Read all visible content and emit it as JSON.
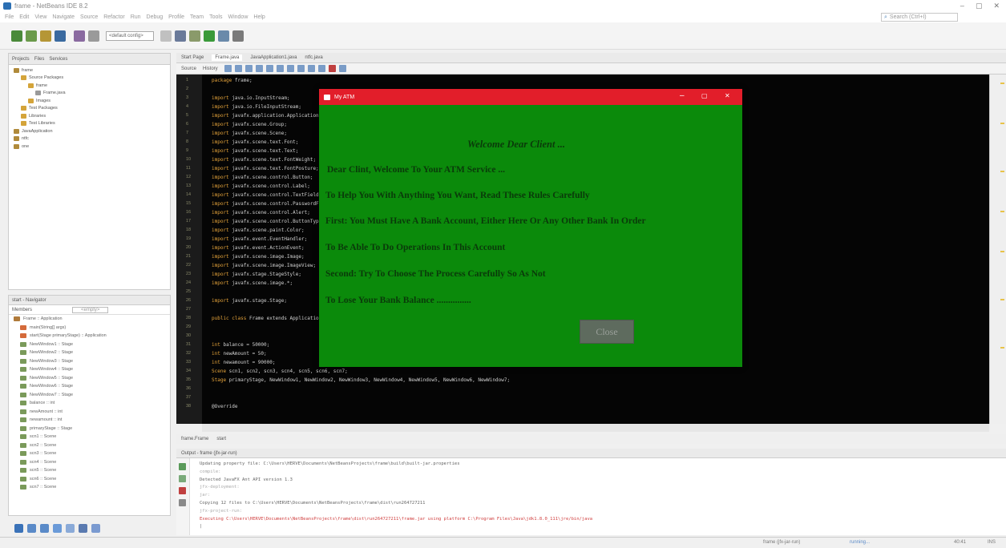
{
  "window": {
    "title": "frame - NetBeans IDE 8.2",
    "controls": [
      "–",
      "▢",
      "✕"
    ]
  },
  "menu": {
    "items": [
      "File",
      "Edit",
      "View",
      "Navigate",
      "Source",
      "Refactor",
      "Run",
      "Debug",
      "Profile",
      "Team",
      "Tools",
      "Window",
      "Help"
    ],
    "search_placeholder": "Search (Ctrl+I)"
  },
  "toolbar": {
    "config": "<default config>"
  },
  "projects": {
    "tabs": [
      "Projects",
      "Files",
      "Services"
    ],
    "tree": [
      {
        "label": "frame",
        "depth": 0
      },
      {
        "label": "Source Packages",
        "depth": 1
      },
      {
        "label": "frame",
        "depth": 2
      },
      {
        "label": "Frame.java",
        "depth": 3
      },
      {
        "label": "Images",
        "depth": 2
      },
      {
        "label": "Test Packages",
        "depth": 1
      },
      {
        "label": "Libraries",
        "depth": 1
      },
      {
        "label": "Test Libraries",
        "depth": 1
      },
      {
        "label": "JavaApplication",
        "depth": 0
      },
      {
        "label": "ntfc",
        "depth": 0
      },
      {
        "label": "one",
        "depth": 0
      }
    ]
  },
  "navigator": {
    "header": "start - Navigator",
    "members_label": "Members",
    "filter": "<empty>",
    "root": "Frame :: Application",
    "members": [
      "main(String[] args)",
      "start(Stage primaryStage) :: Application",
      "NewWindow1 :: Stage",
      "NewWindow2 :: Stage",
      "NewWindow3 :: Stage",
      "NewWindow4 :: Stage",
      "NewWindow5 :: Stage",
      "NewWindow6 :: Stage",
      "NewWindow7 :: Stage",
      "balance :: int",
      "newAmount :: int",
      "newamount :: int",
      "primaryStage :: Stage",
      "scn1 :: Scene",
      "scn2 :: Scene",
      "scn3 :: Scene",
      "scn4 :: Scene",
      "scn5 :: Scene",
      "scn6 :: Scene",
      "scn7 :: Scene"
    ]
  },
  "editor": {
    "tabs": [
      "Start Page",
      "Frame.java",
      "JavaApplication1.java",
      "ntfc.java"
    ],
    "source_label": "Source",
    "history_label": "History",
    "lines": [
      {
        "n": "1",
        "kw": "package",
        "rest": " frame;"
      },
      {
        "n": "2",
        "kw": "",
        "rest": ""
      },
      {
        "n": "3",
        "kw": "import",
        "rest": " java.io.InputStream;"
      },
      {
        "n": "4",
        "kw": "import",
        "rest": " java.io.FileInputStream;"
      },
      {
        "n": "5",
        "kw": "import",
        "rest": " javafx.application.Application;"
      },
      {
        "n": "6",
        "kw": "import",
        "rest": " javafx.scene.Group;"
      },
      {
        "n": "7",
        "kw": "import",
        "rest": " javafx.scene.Scene;"
      },
      {
        "n": "8",
        "kw": "import",
        "rest": " javafx.scene.text.Font;"
      },
      {
        "n": "9",
        "kw": "import",
        "rest": " javafx.scene.text.Text;"
      },
      {
        "n": "10",
        "kw": "import",
        "rest": " javafx.scene.text.FontWeight;"
      },
      {
        "n": "11",
        "kw": "import",
        "rest": " javafx.scene.text.FontPosture;"
      },
      {
        "n": "12",
        "kw": "import",
        "rest": " javafx.scene.control.Button;"
      },
      {
        "n": "13",
        "kw": "import",
        "rest": " javafx.scene.control.Label;"
      },
      {
        "n": "14",
        "kw": "import",
        "rest": " javafx.scene.control.TextField;"
      },
      {
        "n": "15",
        "kw": "import",
        "rest": " javafx.scene.control.PasswordField;"
      },
      {
        "n": "16",
        "kw": "import",
        "rest": " javafx.scene.control.Alert;"
      },
      {
        "n": "17",
        "kw": "import",
        "rest": " javafx.scene.control.ButtonType;"
      },
      {
        "n": "18",
        "kw": "import",
        "rest": " javafx.scene.paint.Color;"
      },
      {
        "n": "19",
        "kw": "import",
        "rest": " javafx.event.EventHandler;"
      },
      {
        "n": "20",
        "kw": "import",
        "rest": " javafx.event.ActionEvent;"
      },
      {
        "n": "21",
        "kw": "import",
        "rest": " javafx.scene.image.Image;"
      },
      {
        "n": "22",
        "kw": "import",
        "rest": " javafx.scene.image.ImageView;"
      },
      {
        "n": "23",
        "kw": "import",
        "rest": " javafx.stage.StageStyle;"
      },
      {
        "n": "24",
        "kw": "import",
        "rest": " javafx.scene.image.*;"
      },
      {
        "n": "25",
        "kw": "",
        "rest": ""
      },
      {
        "n": "26",
        "kw": "import",
        "rest": " javafx.stage.Stage;"
      },
      {
        "n": "27",
        "kw": "",
        "rest": ""
      },
      {
        "n": "28",
        "kw": "public class",
        "rest": " Frame extends Application {"
      },
      {
        "n": "29",
        "kw": "",
        "rest": ""
      },
      {
        "n": "30",
        "kw": "",
        "rest": ""
      },
      {
        "n": "31",
        "kw": "    int",
        "rest": " balance = 50000;"
      },
      {
        "n": "32",
        "kw": "    int",
        "rest": " newAmount = 50;"
      },
      {
        "n": "33",
        "kw": "    int",
        "rest": " newamount = 90000;"
      },
      {
        "n": "34",
        "kw": "    Scene",
        "rest": " scn1, scn2, scn3, scn4, scn5, scn6, scn7;"
      },
      {
        "n": "35",
        "kw": "    Stage",
        "rest": " primaryStage, NewWindow1, NewWindow2, NewWindow3, NewWindow4, NewWindow5, NewWindow6, NewWindow7;"
      },
      {
        "n": "36",
        "kw": "",
        "rest": ""
      },
      {
        "n": "37",
        "kw": "",
        "rest": ""
      },
      {
        "n": "38",
        "kw": "",
        "rest": "    @Override"
      }
    ],
    "breadcrumbs": [
      "frame.Frame",
      "start"
    ]
  },
  "output": {
    "tab": "Output - frame (jfx-jar-run)",
    "lines": [
      "Updating property file: C:\\Users\\HERVE\\Documents\\NetBeansProjects\\frame\\build\\built-jar.properties",
      "compile:",
      "Detected JavaFX Ant API version 1.3",
      "jfx-deployment:",
      "jar:",
      "Copying 12 files to C:\\Users\\HERVE\\Documents\\NetBeansProjects\\frame\\dist\\run264727211",
      "jfx-project-run:",
      "Executing C:\\Users\\HERVE\\Documents\\NetBeansProjects\\frame\\dist\\run264727211\\frame.jar using platform C:\\Program Files\\Java\\jdk1.8.0_111\\jre/bin/java",
      "|"
    ]
  },
  "status": {
    "project": "frame (jfx-jar-run)",
    "running": "running...",
    "position": "40:41",
    "mode": "INS"
  },
  "dialog": {
    "title": "My ATM",
    "heading": "Welcome Dear Client ...",
    "lines": [
      "Dear Clint, Welcome To Your ATM Service ...",
      "To Help You With Anything You Want, Read These Rules Carefully",
      "First: You Must Have A Bank Account, Either Here Or Any Other Bank In Order",
      "To Be Able To Do Operations In This Account",
      "Second: Try To Choose The Process Carefully So As Not",
      "To Lose Your Bank Balance ..............."
    ],
    "close_label": "Close",
    "colors": {
      "background": "#0b8a0b",
      "titlebar": "#e21e2a",
      "text": "#0a3a0a",
      "button": "#5e6b5e"
    }
  }
}
